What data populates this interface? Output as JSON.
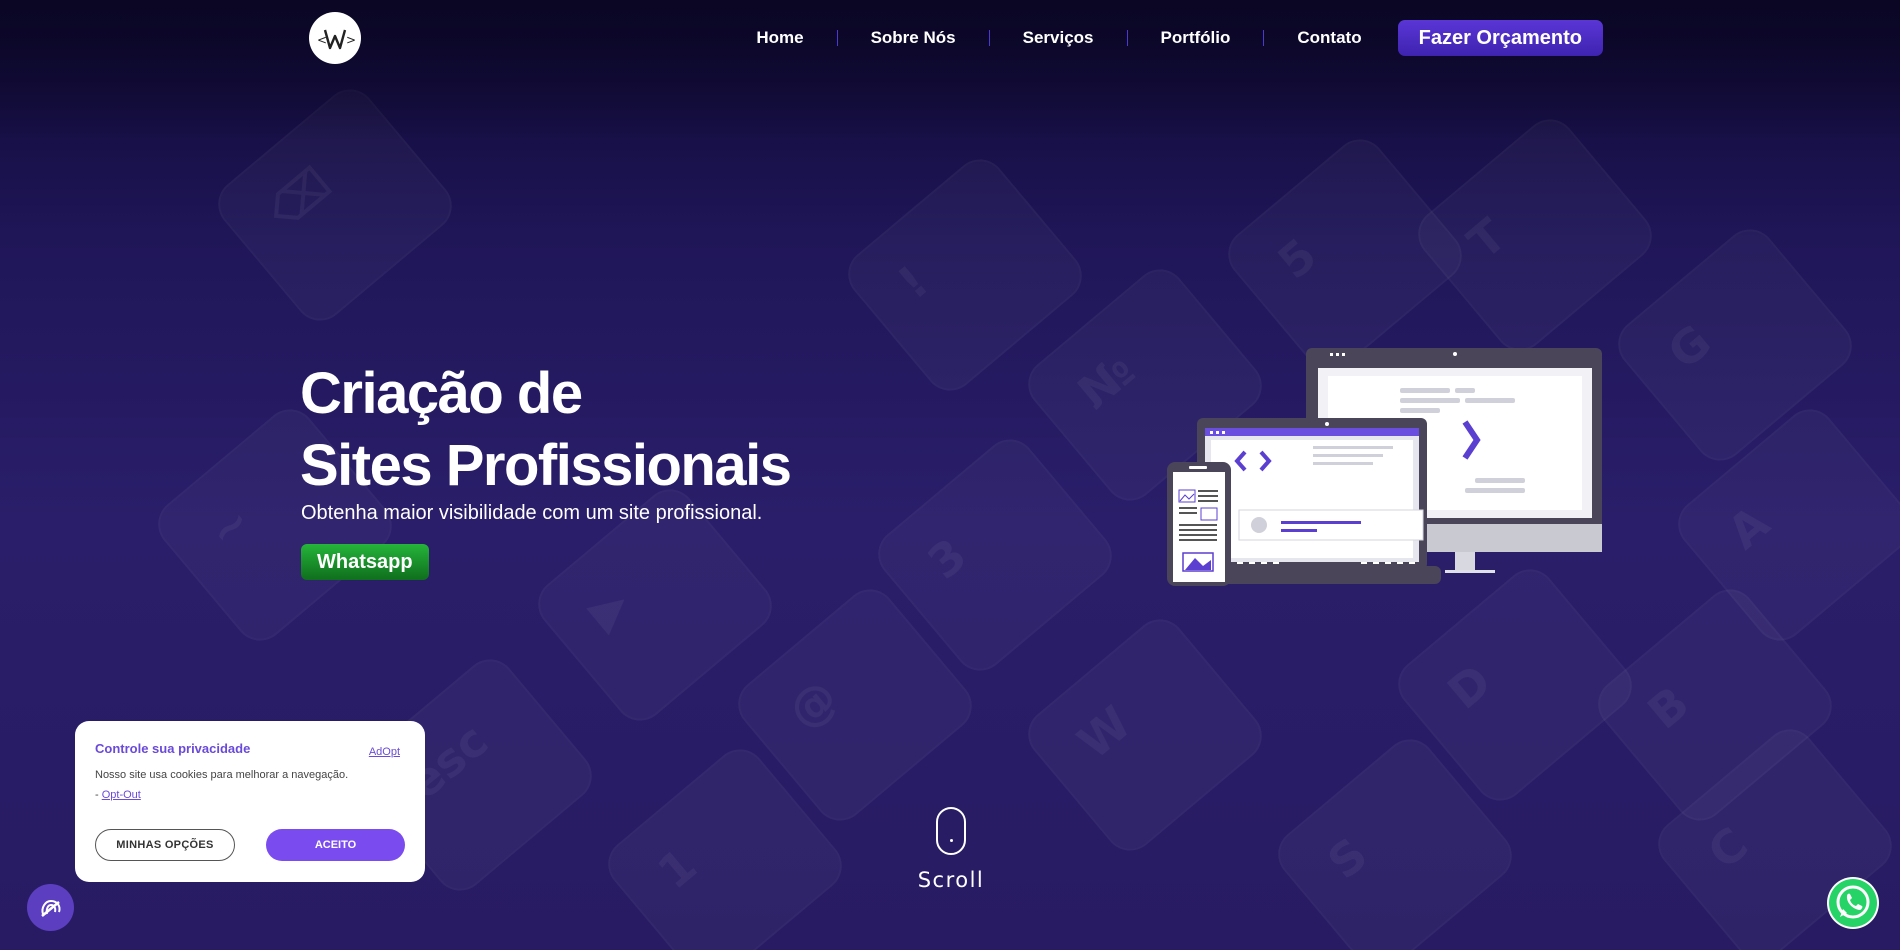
{
  "header": {
    "nav": [
      "Home",
      "Sobre Nós",
      "Serviços",
      "Portfólio",
      "Contato"
    ],
    "cta_label": "Fazer Orçamento"
  },
  "hero": {
    "title_line1": "Criação de",
    "title_line2": "Sites Profissionais",
    "subtitle": "Obtenha maior visibilidade com um site profissional.",
    "button_label": "Whatsapp"
  },
  "scroll_label": "Scroll",
  "cookie": {
    "title": "Controle sua privacidade",
    "brand": "AdOpt",
    "text": "Nosso site usa cookies para melhorar a navegação.",
    "optout_prefix": "- ",
    "optout_label": "Opt-Out",
    "options_label": "MINHAS OPÇÕES",
    "accept_label": "ACEITO"
  },
  "icons": {
    "logo": "w-logo-icon",
    "privacy": "privacy-fingerprint-icon",
    "whatsapp": "whatsapp-icon",
    "mouse": "mouse-scroll-icon"
  },
  "colors": {
    "accent": "#5a36d6",
    "cookie_accent": "#7a4cf0",
    "whatsapp_green": "#25b53a",
    "bg_dark": "#0d0830",
    "bg_mid": "#2a1e6a"
  }
}
